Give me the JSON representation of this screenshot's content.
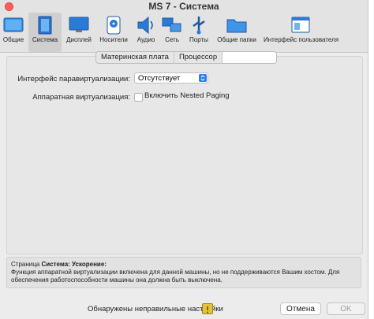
{
  "window": {
    "title": "MS 7 - Система"
  },
  "toolbar": {
    "items": [
      {
        "label": "Общие",
        "icon": "general-icon"
      },
      {
        "label": "Система",
        "icon": "system-chip-icon",
        "selected": true
      },
      {
        "label": "Дисплей",
        "icon": "display-monitor-icon"
      },
      {
        "label": "Носители",
        "icon": "storage-disk-icon"
      },
      {
        "label": "Аудио",
        "icon": "speaker-icon"
      },
      {
        "label": "Сеть",
        "icon": "network-icon"
      },
      {
        "label": "Порты",
        "icon": "usb-ports-icon"
      },
      {
        "label": "Общие папки",
        "icon": "folder-icon"
      },
      {
        "label": "Интерфейс пользователя",
        "icon": "ui-window-icon"
      }
    ]
  },
  "tabs": [
    {
      "label": "Материнская плата"
    },
    {
      "label": "Процессор"
    },
    {
      "label": ""
    }
  ],
  "settings": {
    "paravirt_label": "Интерфейс паравиртуализации:",
    "paravirt_value": "Отсутствует",
    "hwvirt_label": "Аппаратная виртуализация:",
    "nested_paging_label": "Включить Nested Paging",
    "nested_paging_checked": false
  },
  "info": {
    "prefix": "Страница ",
    "page_ref": "Система: Ускорение",
    "suffix": ":",
    "line1": "Функция аппаратной виртуализации включена для данной машины, но не поддерживаются Вашим хостом. Для",
    "line2": "обеспечения работоспособности машины она должна быть выключена."
  },
  "footer": {
    "status_message": "Обнаружены неправильные настройки",
    "cancel_label": "Отмена",
    "ok_label": "OK"
  },
  "colors": {
    "accent": "#2f7cf6",
    "selected_tab_bg": "#cfcfcf"
  }
}
